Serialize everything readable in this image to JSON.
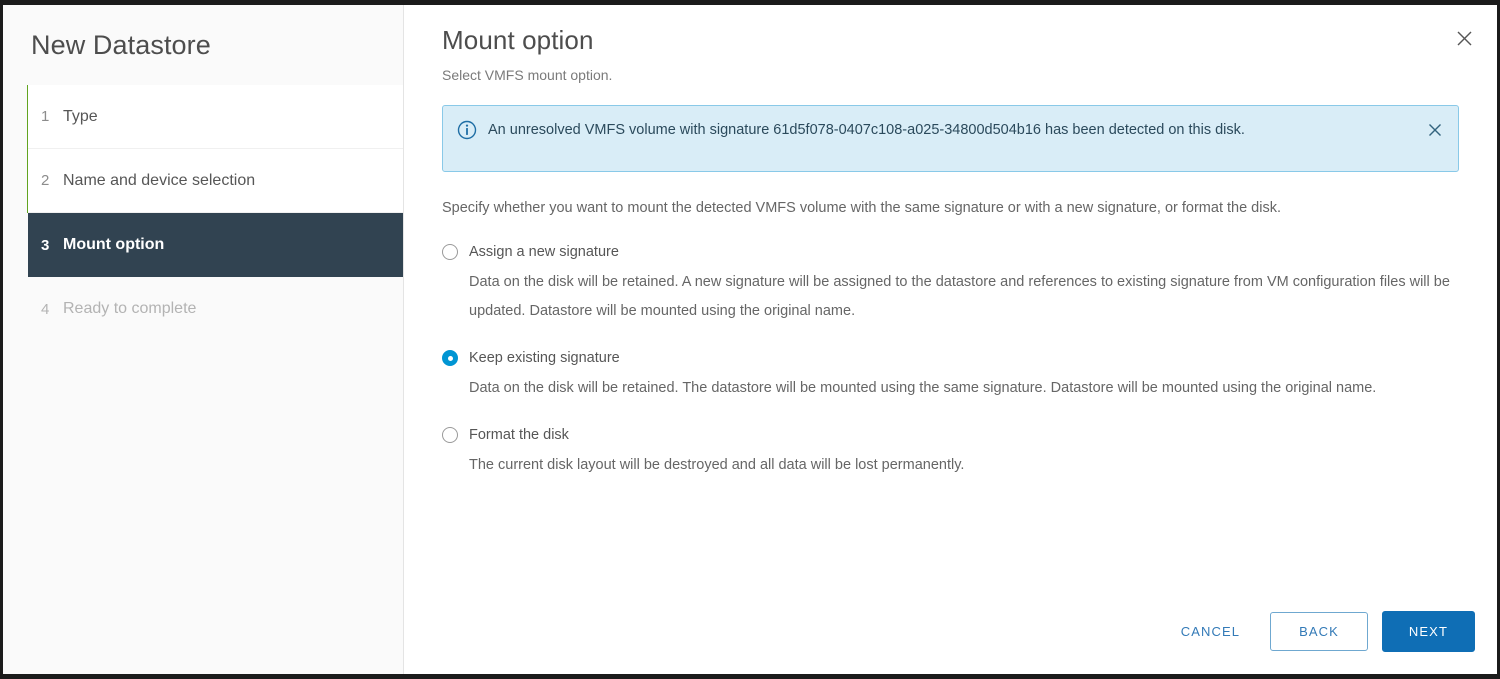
{
  "wizard": {
    "title": "New Datastore",
    "steps": [
      {
        "num": "1",
        "label": "Type",
        "state": "completed"
      },
      {
        "num": "2",
        "label": "Name and device selection",
        "state": "completed"
      },
      {
        "num": "3",
        "label": "Mount option",
        "state": "active"
      },
      {
        "num": "4",
        "label": "Ready to complete",
        "state": "pending"
      }
    ]
  },
  "content": {
    "title": "Mount option",
    "subtitle": "Select VMFS mount option.",
    "close_icon": "close-icon",
    "alert": {
      "icon": "info-circle-icon",
      "text": "An unresolved VMFS volume with signature 61d5f078-0407c108-a025-34800d504b16 has been detected on this disk.",
      "signature": "61d5f078-0407c108-a025-34800d504b16",
      "close_icon": "close-icon",
      "background": "#d9edf7",
      "border": "#89c9e8"
    },
    "instructions": "Specify whether you want to mount the detected VMFS volume with the same signature or with a new signature, or format the disk.",
    "options": [
      {
        "label": "Assign a new signature",
        "description": "Data on the disk will be retained. A new signature will be assigned to the datastore and references to existing signature from VM configuration files will be updated. Datastore will be mounted using the original name.",
        "selected": false
      },
      {
        "label": "Keep existing signature",
        "description": "Data on the disk will be retained. The datastore will be mounted using the same signature. Datastore will be mounted using the original name.",
        "selected": true
      },
      {
        "label": "Format the disk",
        "description": "The current disk layout will be destroyed and all data will be lost permanently.",
        "selected": false
      }
    ]
  },
  "footer": {
    "cancel_label": "CANCEL",
    "back_label": "BACK",
    "next_label": "NEXT"
  },
  "colors": {
    "progress_green": "#62a420",
    "active_step_bg": "#314351",
    "primary_blue": "#0f6eb5",
    "radio_selected": "#0095d3"
  }
}
